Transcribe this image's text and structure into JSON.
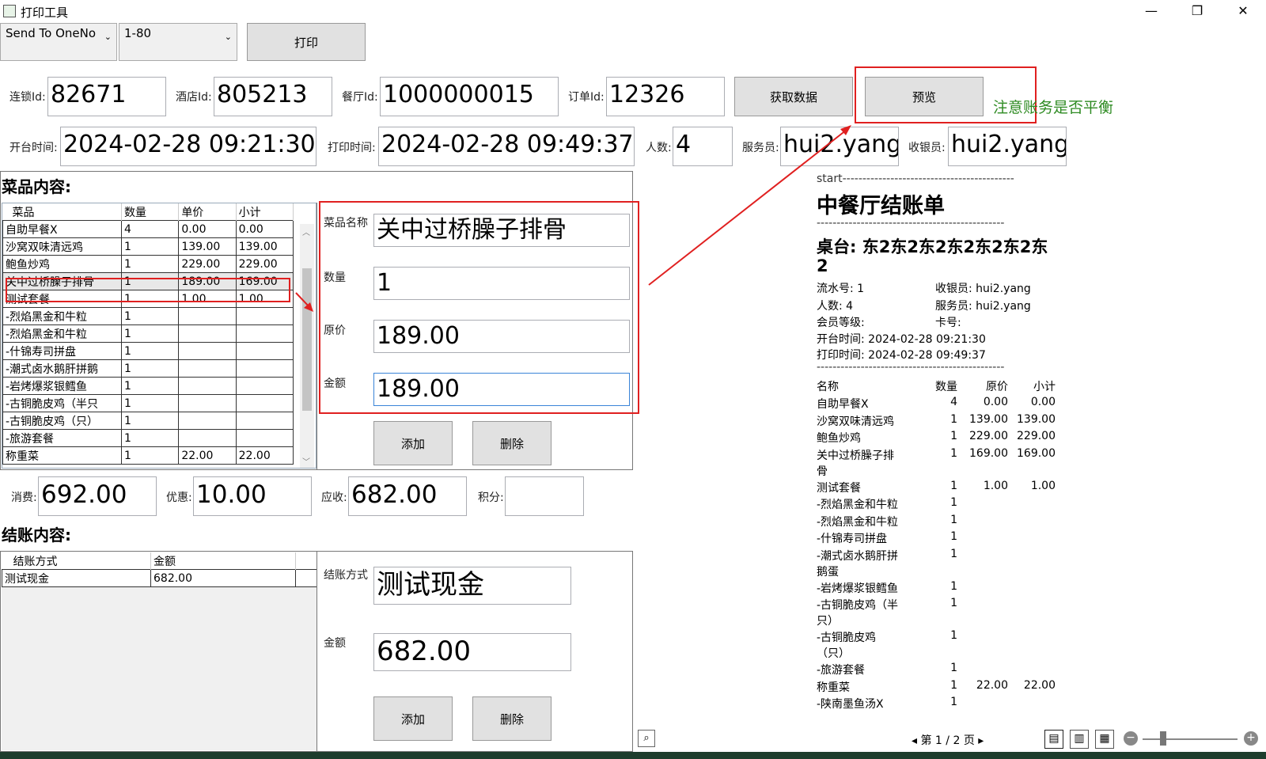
{
  "window": {
    "title": "打印工具",
    "minimize": "—",
    "maximize": "❐",
    "close": "✕"
  },
  "toolbar": {
    "printer": "Send To OneNo",
    "range": "1-80",
    "print_label": "打印"
  },
  "ids": {
    "chain_label": "连锁Id:",
    "chain_value": "82671",
    "hotel_label": "酒店Id:",
    "hotel_value": "805213",
    "restaurant_label": "餐厅Id:",
    "restaurant_value": "1000000015",
    "order_label": "订单Id:",
    "order_value": "12326",
    "fetch_label": "获取数据",
    "preview_label": "预览",
    "note": "注意账务是否平衡"
  },
  "info": {
    "open_label": "开台时间:",
    "open_value": "2024-02-28 09:21:30",
    "print_label": "打印时间:",
    "print_value": "2024-02-28 09:49:37",
    "people_label": "人数:",
    "people_value": "4",
    "waiter_label": "服务员:",
    "waiter_value": "hui2.yang",
    "cashier_label": "收银员:",
    "cashier_value": "hui2.yang"
  },
  "dishes": {
    "title": "菜品内容:",
    "headers": [
      "菜品",
      "数量",
      "单价",
      "小计"
    ],
    "rows": [
      [
        "自助早餐X",
        "4",
        "0.00",
        "0.00"
      ],
      [
        "沙窝双味清远鸡",
        "1",
        "139.00",
        "139.00"
      ],
      [
        "鲍鱼炒鸡",
        "1",
        "229.00",
        "229.00"
      ],
      [
        "关中过桥臊子排骨",
        "1",
        "189.00",
        "169.00"
      ],
      [
        "测试套餐",
        "1",
        "1.00",
        "1.00"
      ],
      [
        "-烈焰黑金和牛粒",
        "1",
        "",
        ""
      ],
      [
        "-烈焰黑金和牛粒",
        "1",
        "",
        ""
      ],
      [
        "-什锦寿司拼盘",
        "1",
        "",
        ""
      ],
      [
        "-潮式卤水鹅肝拼鹅",
        "1",
        "",
        ""
      ],
      [
        "-岩烤爆浆银鳕鱼",
        "1",
        "",
        ""
      ],
      [
        "-古铜脆皮鸡（半只",
        "1",
        "",
        ""
      ],
      [
        "-古铜脆皮鸡（只）",
        "1",
        "",
        ""
      ],
      [
        "-旅游套餐",
        "1",
        "",
        ""
      ],
      [
        "称重菜",
        "1",
        "22.00",
        "22.00"
      ]
    ],
    "edit": {
      "name_label": "菜品名称",
      "name_value": "关中过桥臊子排骨",
      "qty_label": "数量",
      "qty_value": "1",
      "price_label": "原价",
      "price_value": "189.00",
      "amount_label": "金额",
      "amount_value": "189.00",
      "add_label": "添加",
      "delete_label": "删除"
    }
  },
  "totals": {
    "consume_label": "消费:",
    "consume_value": "692.00",
    "discount_label": "优惠:",
    "discount_value": "10.00",
    "receivable_label": "应收:",
    "receivable_value": "682.00",
    "points_label": "积分:",
    "points_value": ""
  },
  "payments": {
    "title": "结账内容:",
    "headers": [
      "结账方式",
      "金额"
    ],
    "rows": [
      [
        "测试现金",
        "682.00"
      ]
    ],
    "edit": {
      "method_label": "结账方式",
      "method_value": "测试现金",
      "amount_label": "金额",
      "amount_value": "682.00",
      "add_label": "添加",
      "delete_label": "删除"
    }
  },
  "preview": {
    "start": "start-------------------------------------------",
    "title": "中餐厅结账单",
    "sep": "-----------------------------------------------",
    "table_line1": "桌台: 东2东2东2东2东2东2东",
    "table_line2": "2",
    "serial": "流水号: 1",
    "cashier": "收银员: hui2.yang",
    "people": "人数: 4",
    "waiter": "服务员: hui2.yang",
    "member": "会员等级:",
    "card": "卡号:",
    "open": "开台时间: 2024-02-28 09:21:30",
    "print": "打印时间: 2024-02-28 09:49:37",
    "headers": [
      "名称",
      "数量",
      "原价",
      "小计"
    ],
    "items": [
      {
        "name": "自助早餐X",
        "name2": "",
        "qty": "4",
        "price": "0.00",
        "sub": "0.00"
      },
      {
        "name": "沙窝双味清远鸡",
        "name2": "",
        "qty": "1",
        "price": "139.00",
        "sub": "139.00"
      },
      {
        "name": "鲍鱼炒鸡",
        "name2": "",
        "qty": "1",
        "price": "229.00",
        "sub": "229.00"
      },
      {
        "name": "关中过桥臊子排",
        "name2": "骨",
        "qty": "1",
        "price": "169.00",
        "sub": "169.00"
      },
      {
        "name": "测试套餐",
        "name2": "",
        "qty": "1",
        "price": "1.00",
        "sub": "1.00"
      },
      {
        "name": "-烈焰黑金和牛粒",
        "name2": "",
        "qty": "1",
        "price": "",
        "sub": ""
      },
      {
        "name": "-烈焰黑金和牛粒",
        "name2": "",
        "qty": "1",
        "price": "",
        "sub": ""
      },
      {
        "name": "-什锦寿司拼盘",
        "name2": "",
        "qty": "1",
        "price": "",
        "sub": ""
      },
      {
        "name": "-潮式卤水鹅肝拼",
        "name2": "鹅蛋",
        "qty": "1",
        "price": "",
        "sub": ""
      },
      {
        "name": "-岩烤爆浆银鳕鱼",
        "name2": "",
        "qty": "1",
        "price": "",
        "sub": ""
      },
      {
        "name": "-古铜脆皮鸡（半",
        "name2": "只）",
        "qty": "1",
        "price": "",
        "sub": ""
      },
      {
        "name": "-古铜脆皮鸡",
        "name2": "（只）",
        "qty": "1",
        "price": "",
        "sub": ""
      },
      {
        "name": "-旅游套餐",
        "name2": "",
        "qty": "1",
        "price": "",
        "sub": ""
      },
      {
        "name": "称重菜",
        "name2": "",
        "qty": "1",
        "price": "22.00",
        "sub": "22.00"
      },
      {
        "name": "-陕南墨鱼汤X",
        "name2": "",
        "qty": "1",
        "price": "",
        "sub": ""
      }
    ],
    "page_text": "第 1 / 2 页"
  },
  "colors": {
    "accent_red": "#e02020",
    "note_green": "#2e8b22"
  }
}
